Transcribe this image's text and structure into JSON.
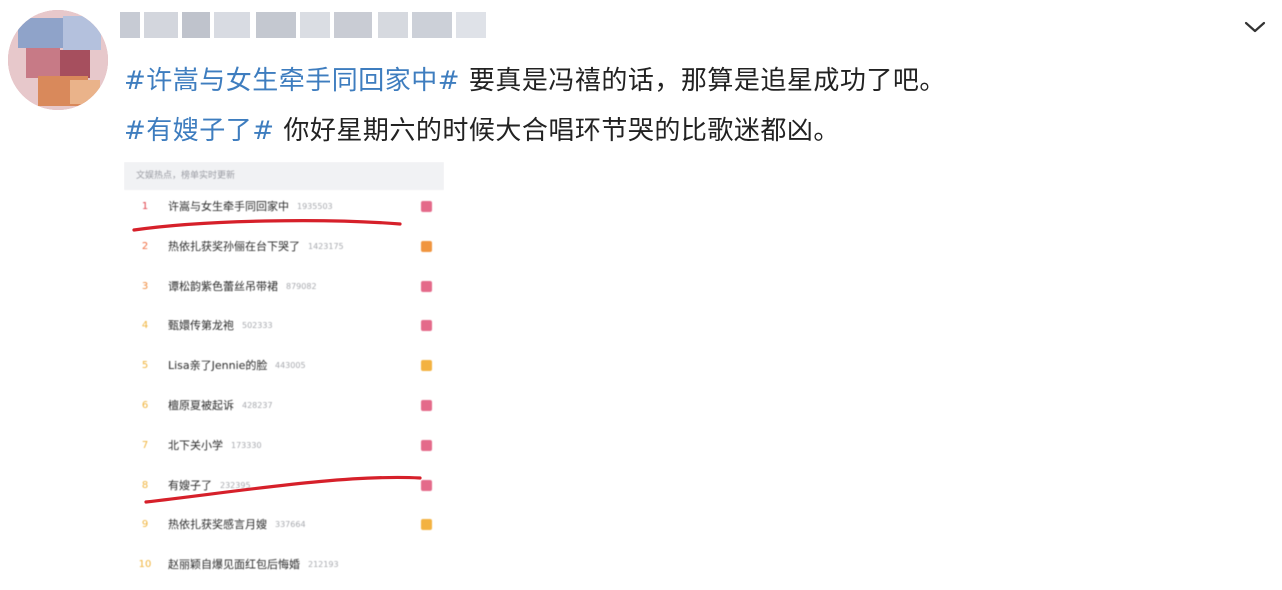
{
  "post": {
    "line1": {
      "tag": "#许嵩与女生牵手同回家中#",
      "text": "要真是冯禧的话，那算是追星成功了吧。"
    },
    "line2": {
      "tag": "#有嫂子了#",
      "text": "你好星期六的时候大合唱环节哭的比歌迷都凶。"
    }
  },
  "screenshot": {
    "header": "文娱热点，榜单实时更新",
    "rows": [
      {
        "rank": "1",
        "title": "许嵩与女生牵手同回家中",
        "count": "1935503",
        "badge": "#e46a8a",
        "rank_color": "#e0424a"
      },
      {
        "rank": "2",
        "title": "热依扎获奖孙俪在台下哭了",
        "count": "1423175",
        "badge": "#f0953f",
        "rank_color": "#f06a3c"
      },
      {
        "rank": "3",
        "title": "谭松韵紫色蕾丝吊带裙",
        "count": "879082",
        "badge": "#e46a8a",
        "rank_color": "#f08a3c"
      },
      {
        "rank": "4",
        "title": "甄嬛传第龙袍",
        "count": "502333",
        "badge": "#e46a8a",
        "rank_color": "#f0b43c"
      },
      {
        "rank": "5",
        "title": "Lisa亲了Jennie的脸",
        "count": "443005",
        "badge": "#f3b241",
        "rank_color": "#f0b43c"
      },
      {
        "rank": "6",
        "title": "檀原夏被起诉",
        "count": "428237",
        "badge": "#e46a8a",
        "rank_color": "#f0b43c"
      },
      {
        "rank": "7",
        "title": "北下关小学",
        "count": "173330",
        "badge": "#e46a8a",
        "rank_color": "#f0b43c"
      },
      {
        "rank": "8",
        "title": "有嫂子了",
        "count": "232395",
        "badge": "#e46a8a",
        "rank_color": "#f0b43c"
      },
      {
        "rank": "9",
        "title": "热依扎获奖感言月嫂",
        "count": "337664",
        "badge": "#f3b241",
        "rank_color": "#f0b43c"
      },
      {
        "rank": "10",
        "title": "赵丽颖自爆见面红包后悔婚",
        "count": "212193",
        "badge": "",
        "rank_color": "#f0b43c"
      }
    ]
  },
  "colors": {
    "hashtag": "#3e7dbf",
    "underline": "#d6202a"
  }
}
